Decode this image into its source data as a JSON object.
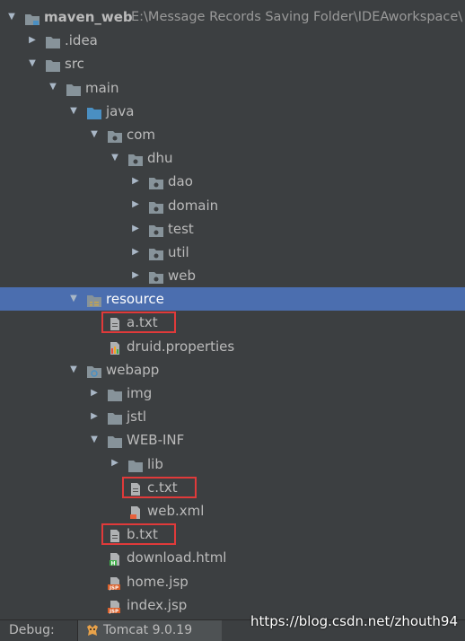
{
  "project": {
    "name": "maven_web",
    "path": "E:\\Message Records Saving Folder\\IDEAworkspace\\"
  },
  "tree": [
    {
      "label": "maven_web",
      "depth": 0,
      "arrow": "down",
      "icon": "module",
      "bold": true,
      "path": "E:\\Message Records Saving Folder\\IDEAworkspace\\"
    },
    {
      "label": ".idea",
      "depth": 1,
      "arrow": "right",
      "icon": "folder"
    },
    {
      "label": "src",
      "depth": 1,
      "arrow": "down",
      "icon": "folder"
    },
    {
      "label": "main",
      "depth": 2,
      "arrow": "down",
      "icon": "folder"
    },
    {
      "label": "java",
      "depth": 3,
      "arrow": "down",
      "icon": "source-folder"
    },
    {
      "label": "com",
      "depth": 4,
      "arrow": "down",
      "icon": "package"
    },
    {
      "label": "dhu",
      "depth": 5,
      "arrow": "down",
      "icon": "package"
    },
    {
      "label": "dao",
      "depth": 6,
      "arrow": "right",
      "icon": "package"
    },
    {
      "label": "domain",
      "depth": 6,
      "arrow": "right",
      "icon": "package"
    },
    {
      "label": "test",
      "depth": 6,
      "arrow": "right",
      "icon": "package"
    },
    {
      "label": "util",
      "depth": 6,
      "arrow": "right",
      "icon": "package"
    },
    {
      "label": "web",
      "depth": 6,
      "arrow": "right",
      "icon": "package"
    },
    {
      "label": "resource",
      "depth": 3,
      "arrow": "down",
      "icon": "resource-folder",
      "selected": true
    },
    {
      "label": "a.txt",
      "depth": 4,
      "arrow": "none",
      "icon": "text-file",
      "highlight": true
    },
    {
      "label": "druid.properties",
      "depth": 4,
      "arrow": "none",
      "icon": "properties-file"
    },
    {
      "label": "webapp",
      "depth": 3,
      "arrow": "down",
      "icon": "web-folder"
    },
    {
      "label": "img",
      "depth": 4,
      "arrow": "right",
      "icon": "folder"
    },
    {
      "label": "jstl",
      "depth": 4,
      "arrow": "right",
      "icon": "folder"
    },
    {
      "label": "WEB-INF",
      "depth": 4,
      "arrow": "down",
      "icon": "folder"
    },
    {
      "label": "lib",
      "depth": 5,
      "arrow": "right",
      "icon": "folder"
    },
    {
      "label": "c.txt",
      "depth": 5,
      "arrow": "none",
      "icon": "text-file",
      "highlight": true
    },
    {
      "label": "web.xml",
      "depth": 5,
      "arrow": "none",
      "icon": "xml-file"
    },
    {
      "label": "b.txt",
      "depth": 4,
      "arrow": "none",
      "icon": "text-file",
      "highlight": true
    },
    {
      "label": "download.html",
      "depth": 4,
      "arrow": "none",
      "icon": "html-file"
    },
    {
      "label": "home.jsp",
      "depth": 4,
      "arrow": "none",
      "icon": "jsp-file"
    },
    {
      "label": "index.jsp",
      "depth": 4,
      "arrow": "none",
      "icon": "jsp-file"
    }
  ],
  "statusbar": {
    "debug_label": "Debug:",
    "tab_label": "Tomcat 9.0.19",
    "tab_icon": "tomcat-icon"
  },
  "watermark": "https://blog.csdn.net/zhouth94",
  "colors": {
    "background": "#3c3f41",
    "selection": "#4b6eaf",
    "highlight_box": "#e03a3a",
    "folder": "#87939a",
    "source_folder": "#4a8fc2"
  }
}
